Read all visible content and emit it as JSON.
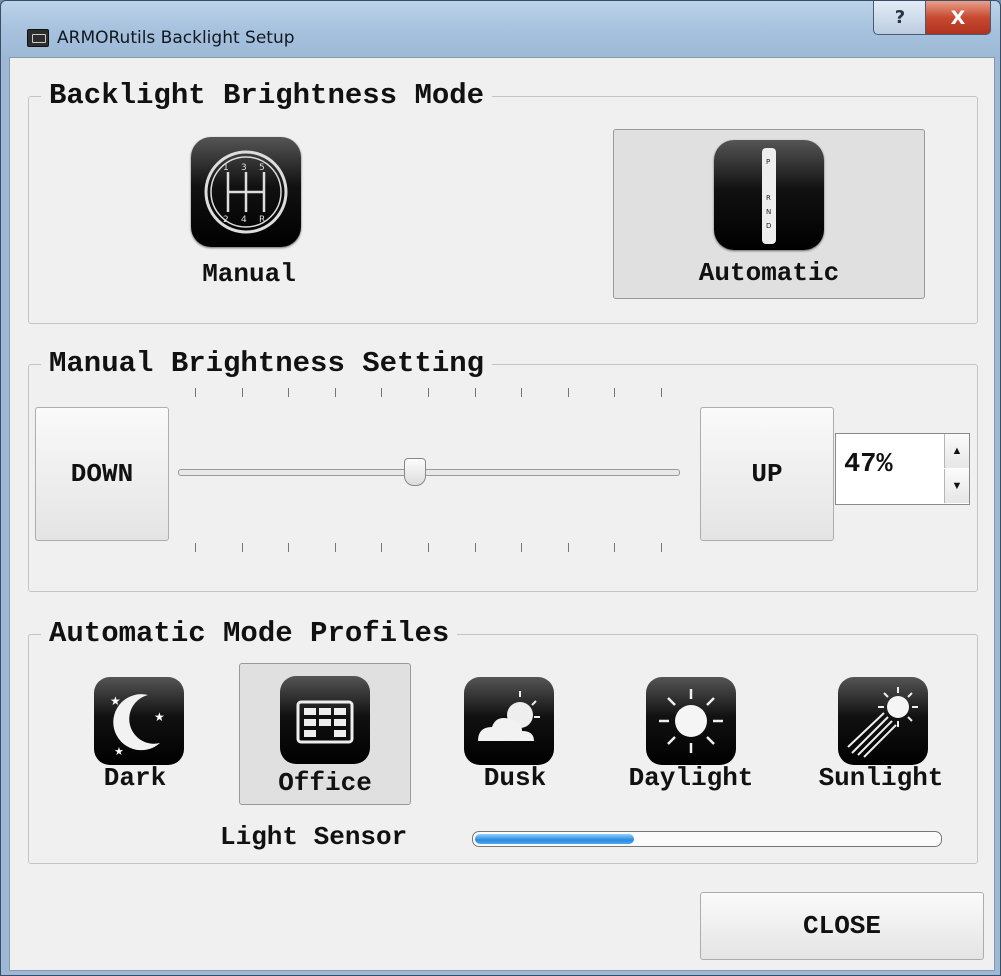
{
  "window": {
    "title": "ARMORutils Backlight Setup",
    "help_label": "?",
    "close_label": "X"
  },
  "brightness_mode": {
    "legend": "Backlight Brightness Mode",
    "manual_label": "Manual",
    "automatic_label": "Automatic",
    "selected": "Automatic"
  },
  "manual_setting": {
    "legend": "Manual Brightness Setting",
    "down_label": "DOWN",
    "up_label": "UP",
    "value": "47%",
    "slider_fraction": 0.47,
    "tick_count": 11
  },
  "profiles": {
    "legend": "Automatic Mode Profiles",
    "items": [
      {
        "label": "Dark",
        "icon": "moon-stars-icon"
      },
      {
        "label": "Office",
        "icon": "office-building-icon"
      },
      {
        "label": "Dusk",
        "icon": "sun-cloud-icon"
      },
      {
        "label": "Daylight",
        "icon": "sun-icon"
      },
      {
        "label": "Sunlight",
        "icon": "sun-rays-icon"
      }
    ],
    "selected": "Office",
    "sensor_label": "Light Sensor",
    "sensor_fraction": 0.34
  },
  "footer": {
    "close_label": "CLOSE"
  }
}
